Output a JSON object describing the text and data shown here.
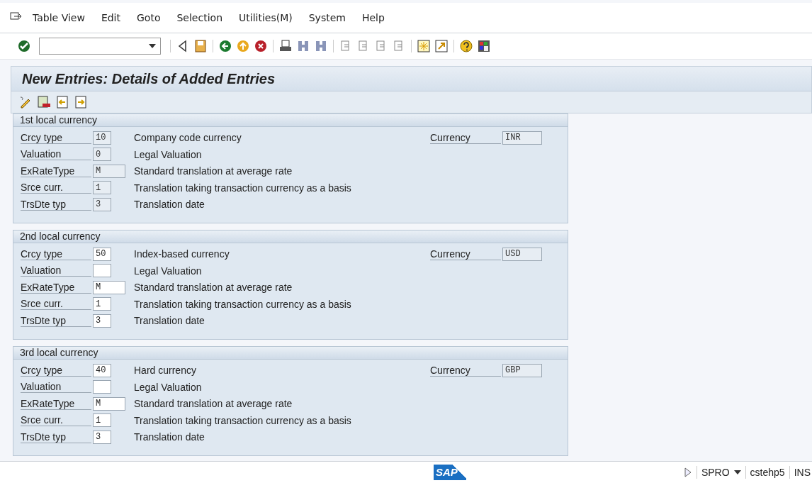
{
  "menu": [
    {
      "label": "Table View"
    },
    {
      "label": "Edit"
    },
    {
      "label": "Goto"
    },
    {
      "label": "Selection"
    },
    {
      "label": "Utilities(M)"
    },
    {
      "label": "System"
    },
    {
      "label": "Help"
    }
  ],
  "title": "New Entries: Details of Added Entries",
  "sections": [
    {
      "title": "1st local currency",
      "currency": {
        "label": "Currency",
        "value": "INR",
        "disabled": true
      },
      "fields": [
        {
          "label": "Crcy type",
          "value": "10",
          "wide": false,
          "disabled": true,
          "description": "Company code currency"
        },
        {
          "label": "Valuation",
          "value": "0",
          "wide": false,
          "disabled": true,
          "description": "Legal Valuation"
        },
        {
          "label": "ExRateType",
          "value": "M",
          "wide": true,
          "disabled": true,
          "description": "Standard translation at average rate"
        },
        {
          "label": "Srce curr.",
          "value": "1",
          "wide": false,
          "disabled": true,
          "description": "Translation taking transaction currency as a basis"
        },
        {
          "label": "TrsDte typ",
          "value": "3",
          "wide": false,
          "disabled": true,
          "description": "Translation date"
        }
      ]
    },
    {
      "title": "2nd local currency",
      "currency": {
        "label": "Currency",
        "value": "USD",
        "disabled": true
      },
      "fields": [
        {
          "label": "Crcy type",
          "value": "50",
          "wide": false,
          "disabled": false,
          "description": "Index-based currency"
        },
        {
          "label": "Valuation",
          "wide": false,
          "disabled": false,
          "description": "Legal Valuation"
        },
        {
          "label": "ExRateType",
          "value": "M",
          "wide": true,
          "disabled": false,
          "description": "Standard translation at average rate"
        },
        {
          "label": "Srce curr.",
          "value": "1",
          "wide": false,
          "disabled": false,
          "description": "Translation taking transaction currency as a basis"
        },
        {
          "label": "TrsDte typ",
          "value": "3",
          "wide": false,
          "disabled": false,
          "description": "Translation date"
        }
      ]
    },
    {
      "title": "3rd local currency",
      "currency": {
        "label": "Currency",
        "value": "GBP",
        "disabled": true
      },
      "fields": [
        {
          "label": "Crcy type",
          "value": "40",
          "wide": false,
          "disabled": false,
          "description": "Hard currency"
        },
        {
          "label": "Valuation",
          "wide": false,
          "disabled": false,
          "description": "Legal Valuation"
        },
        {
          "label": "ExRateType",
          "value": "M",
          "wide": true,
          "disabled": false,
          "description": "Standard translation at average rate"
        },
        {
          "label": "Srce curr.",
          "value": "1",
          "wide": false,
          "disabled": false,
          "description": "Translation taking transaction currency as a basis"
        },
        {
          "label": "TrsDte typ",
          "value": "3",
          "wide": false,
          "disabled": false,
          "description": "Translation date"
        }
      ]
    }
  ],
  "status_bar": {
    "logo_text": "SAP",
    "transaction": "SPRO",
    "server": "cstehp5",
    "mode": "INS"
  }
}
